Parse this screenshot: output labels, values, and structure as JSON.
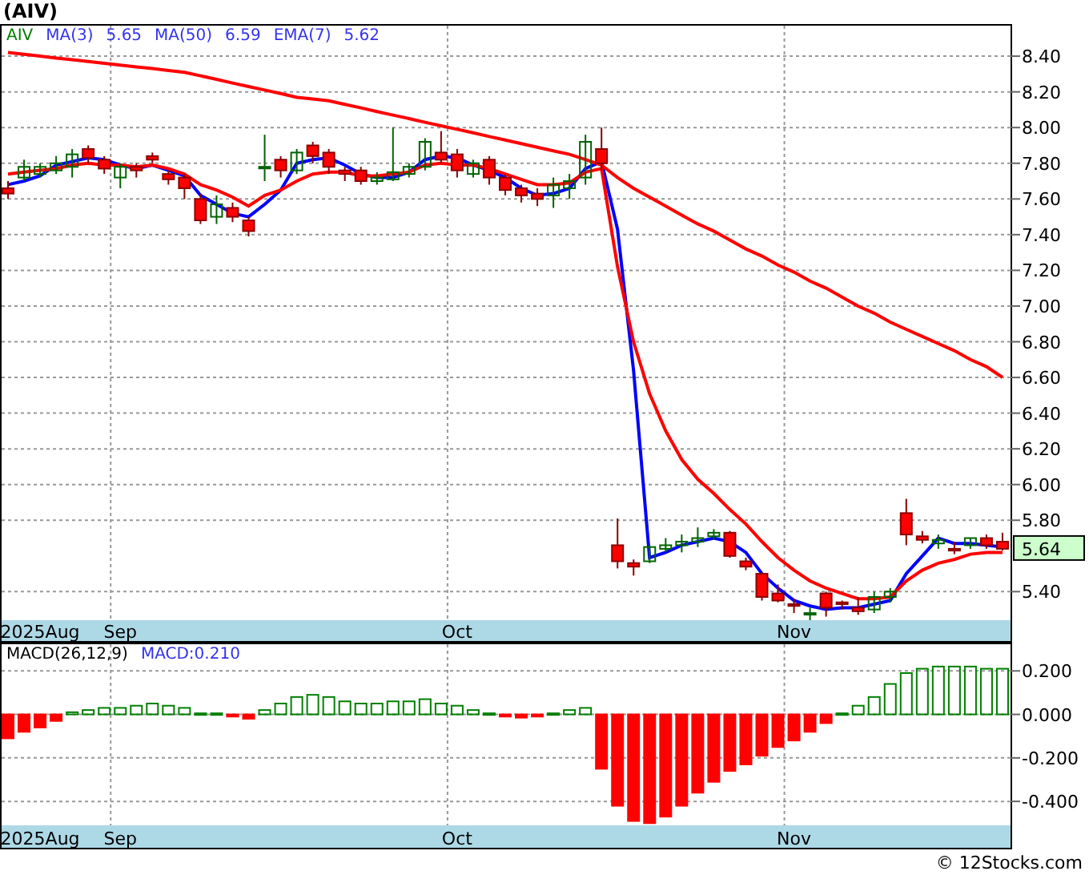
{
  "title": "(AIV)",
  "price_panel": {
    "legend": [
      {
        "text": "AIV",
        "color": "#008000"
      },
      {
        "text": "5.65",
        "color": "#3333ee"
      },
      {
        "text": "6.59",
        "color": "#3333ee"
      },
      {
        "text": "5.62",
        "color": "#3333ee"
      }
    ],
    "last_price": "5.64",
    "chart_data": {
      "type": "candlestick",
      "grid": true,
      "ylim": [
        5.24,
        8.58
      ],
      "categories": [
        null,
        null,
        "2025Aug",
        null,
        null,
        null,
        null,
        "Sep",
        null,
        null,
        null,
        null,
        null,
        null,
        null,
        null,
        null,
        null,
        null,
        null,
        null,
        null,
        null,
        null,
        null,
        null,
        null,
        null,
        "Oct",
        null,
        null,
        null,
        null,
        null,
        null,
        null,
        null,
        null,
        null,
        null,
        null,
        null,
        null,
        null,
        null,
        null,
        null,
        null,
        null,
        "Nov",
        null,
        null,
        null,
        null,
        null,
        null,
        null,
        null,
        null,
        null,
        null,
        null,
        null
      ],
      "yticks": [
        {
          "value": 8.4,
          "label": "8.40"
        },
        {
          "value": 8.2,
          "label": "8.20"
        },
        {
          "value": 8.0,
          "label": "8.00"
        },
        {
          "value": 7.8,
          "label": "7.80"
        },
        {
          "value": 7.6,
          "label": "7.60"
        },
        {
          "value": 7.4,
          "label": "7.40"
        },
        {
          "value": 7.2,
          "label": "7.20"
        },
        {
          "value": 7.0,
          "label": "7.00"
        },
        {
          "value": 6.8,
          "label": "6.80"
        },
        {
          "value": 6.6,
          "label": "6.60"
        },
        {
          "value": 6.4,
          "label": "6.40"
        },
        {
          "value": 6.2,
          "label": "6.20"
        },
        {
          "value": 6.0,
          "label": "6.00"
        },
        {
          "value": 5.8,
          "label": "5.80"
        },
        {
          "value": 5.4,
          "label": "5.40"
        }
      ],
      "ohlc": [
        [
          7.66,
          7.7,
          7.6,
          7.63
        ],
        [
          7.72,
          7.82,
          7.7,
          7.78
        ],
        [
          7.74,
          7.8,
          7.72,
          7.78
        ],
        [
          7.76,
          7.84,
          7.74,
          7.8
        ],
        [
          7.78,
          7.88,
          7.72,
          7.85
        ],
        [
          7.88,
          7.9,
          7.8,
          7.83
        ],
        [
          7.82,
          7.84,
          7.74,
          7.77
        ],
        [
          7.72,
          7.8,
          7.66,
          7.78
        ],
        [
          7.78,
          7.8,
          7.72,
          7.76
        ],
        [
          7.84,
          7.86,
          7.8,
          7.82
        ],
        [
          7.74,
          7.76,
          7.68,
          7.71
        ],
        [
          7.72,
          7.74,
          7.6,
          7.66
        ],
        [
          7.6,
          7.63,
          7.46,
          7.48
        ],
        [
          7.5,
          7.62,
          7.46,
          7.57
        ],
        [
          7.55,
          7.58,
          7.47,
          7.5
        ],
        [
          7.48,
          7.5,
          7.39,
          7.42
        ],
        [
          7.78,
          7.96,
          7.7,
          7.78
        ],
        [
          7.82,
          7.84,
          7.72,
          7.76
        ],
        [
          7.76,
          7.88,
          7.74,
          7.86
        ],
        [
          7.9,
          7.92,
          7.8,
          7.84
        ],
        [
          7.86,
          7.88,
          7.74,
          7.78
        ],
        [
          7.76,
          7.78,
          7.7,
          7.74
        ],
        [
          7.76,
          7.78,
          7.68,
          7.7
        ],
        [
          7.7,
          7.75,
          7.68,
          7.72
        ],
        [
          7.71,
          8.0,
          7.7,
          7.75
        ],
        [
          7.74,
          7.8,
          7.72,
          7.78
        ],
        [
          7.78,
          7.94,
          7.76,
          7.92
        ],
        [
          7.86,
          7.98,
          7.8,
          7.82
        ],
        [
          7.85,
          7.88,
          7.72,
          7.76
        ],
        [
          7.74,
          7.82,
          7.72,
          7.8
        ],
        [
          7.82,
          7.84,
          7.68,
          7.72
        ],
        [
          7.72,
          7.74,
          7.62,
          7.65
        ],
        [
          7.66,
          7.68,
          7.58,
          7.62
        ],
        [
          7.63,
          7.66,
          7.56,
          7.6
        ],
        [
          7.62,
          7.72,
          7.55,
          7.68
        ],
        [
          7.66,
          7.74,
          7.6,
          7.7
        ],
        [
          7.72,
          7.96,
          7.68,
          7.92
        ],
        [
          7.88,
          8.0,
          7.76,
          7.8
        ],
        [
          5.66,
          5.81,
          5.53,
          5.57
        ],
        [
          5.56,
          5.58,
          5.49,
          5.54
        ],
        [
          5.57,
          5.66,
          5.56,
          5.65
        ],
        [
          5.64,
          5.7,
          5.62,
          5.66
        ],
        [
          5.66,
          5.72,
          5.62,
          5.68
        ],
        [
          5.68,
          5.76,
          5.65,
          5.7
        ],
        [
          5.71,
          5.75,
          5.69,
          5.73
        ],
        [
          5.73,
          5.74,
          5.59,
          5.6
        ],
        [
          5.57,
          5.59,
          5.52,
          5.54
        ],
        [
          5.5,
          5.51,
          5.35,
          5.37
        ],
        [
          5.39,
          5.44,
          5.34,
          5.35
        ],
        [
          5.33,
          5.36,
          5.28,
          5.32
        ],
        [
          5.28,
          5.31,
          5.24,
          5.28
        ],
        [
          5.39,
          5.4,
          5.26,
          5.31
        ],
        [
          5.34,
          5.35,
          5.3,
          5.33
        ],
        [
          5.31,
          5.37,
          5.27,
          5.29
        ],
        [
          5.3,
          5.4,
          5.28,
          5.37
        ],
        [
          5.37,
          5.42,
          5.34,
          5.4
        ],
        [
          5.84,
          5.92,
          5.66,
          5.72
        ],
        [
          5.71,
          5.74,
          5.67,
          5.69
        ],
        [
          5.67,
          5.72,
          5.64,
          5.69
        ],
        [
          5.64,
          5.68,
          5.61,
          5.63
        ],
        [
          5.66,
          5.7,
          5.64,
          5.7
        ],
        [
          5.7,
          5.72,
          5.64,
          5.66
        ],
        [
          5.68,
          5.73,
          5.63,
          5.64
        ]
      ],
      "series": [
        {
          "name": "MA(3)",
          "type": "line",
          "color": "#0000ff",
          "values": [
            7.68,
            7.7,
            7.73,
            7.79,
            7.81,
            7.83,
            7.82,
            7.79,
            7.77,
            7.79,
            7.76,
            7.73,
            7.62,
            7.57,
            7.52,
            7.5,
            7.57,
            7.65,
            7.8,
            7.82,
            7.83,
            7.79,
            7.74,
            7.72,
            7.72,
            7.75,
            7.82,
            7.84,
            7.83,
            7.79,
            7.76,
            7.72,
            7.66,
            7.62,
            7.63,
            7.66,
            7.77,
            7.81,
            7.43,
            6.64,
            5.59,
            5.62,
            5.66,
            5.68,
            5.7,
            5.68,
            5.62,
            5.5,
            5.42,
            5.35,
            5.32,
            5.3,
            5.31,
            5.31,
            5.33,
            5.35,
            5.5,
            5.6,
            5.7,
            5.67,
            5.67,
            5.66,
            5.65
          ]
        },
        {
          "name": "MA(50)",
          "type": "line",
          "color": "#ff0000",
          "values": [
            8.42,
            8.41,
            8.4,
            8.39,
            8.38,
            8.37,
            8.36,
            8.35,
            8.34,
            8.33,
            8.32,
            8.31,
            8.29,
            8.27,
            8.25,
            8.23,
            8.21,
            8.19,
            8.17,
            8.16,
            8.15,
            8.13,
            8.11,
            8.09,
            8.07,
            8.05,
            8.03,
            8.01,
            7.99,
            7.97,
            7.95,
            7.93,
            7.91,
            7.89,
            7.87,
            7.85,
            7.82,
            7.79,
            7.72,
            7.66,
            7.61,
            7.56,
            7.51,
            7.46,
            7.42,
            7.37,
            7.32,
            7.28,
            7.23,
            7.19,
            7.14,
            7.1,
            7.05,
            7.0,
            6.96,
            6.91,
            6.87,
            6.83,
            6.79,
            6.75,
            6.7,
            6.66,
            6.6
          ]
        },
        {
          "name": "EMA(7)",
          "type": "line",
          "color": "#ff0000",
          "values": [
            7.74,
            7.75,
            7.76,
            7.77,
            7.79,
            7.8,
            7.79,
            7.79,
            7.78,
            7.79,
            7.77,
            7.74,
            7.68,
            7.65,
            7.61,
            7.56,
            7.62,
            7.65,
            7.7,
            7.74,
            7.75,
            7.75,
            7.73,
            7.73,
            7.74,
            7.75,
            7.79,
            7.8,
            7.79,
            7.79,
            7.77,
            7.74,
            7.71,
            7.68,
            7.68,
            7.69,
            7.75,
            7.77,
            7.22,
            6.8,
            6.51,
            6.3,
            6.14,
            6.03,
            5.95,
            5.86,
            5.78,
            5.68,
            5.59,
            5.52,
            5.46,
            5.42,
            5.39,
            5.36,
            5.36,
            5.37,
            5.46,
            5.52,
            5.56,
            5.58,
            5.61,
            5.62,
            5.62
          ]
        }
      ]
    }
  },
  "macd_panel": {
    "legend": [
      {
        "text": "MACD(26,12,9)",
        "color": "#000000"
      },
      {
        "text": "MACD:0.210",
        "color": "#3333ee"
      }
    ],
    "chart_data": {
      "type": "bar",
      "grid": true,
      "ylim": [
        -0.51,
        0.33
      ],
      "categories": [
        null,
        null,
        "2025Aug",
        null,
        null,
        null,
        null,
        "Sep",
        null,
        null,
        null,
        null,
        null,
        null,
        null,
        null,
        null,
        null,
        null,
        null,
        null,
        null,
        null,
        null,
        null,
        null,
        null,
        null,
        "Oct",
        null,
        null,
        null,
        null,
        null,
        null,
        null,
        null,
        null,
        null,
        null,
        null,
        null,
        null,
        null,
        null,
        null,
        null,
        null,
        null,
        "Nov",
        null,
        null,
        null,
        null,
        null,
        null,
        null,
        null,
        null,
        null,
        null,
        null,
        null
      ],
      "yticks": [
        {
          "value": 0.2,
          "label": "0.200"
        },
        {
          "value": 0,
          "label": "0.000"
        },
        {
          "value": -0.2,
          "label": "-0.200"
        },
        {
          "value": -0.4,
          "label": "-0.400"
        }
      ],
      "series": [
        {
          "color": "#008000",
          "values": [
            null,
            null,
            null,
            null,
            0.01,
            0.02,
            0.03,
            0.03,
            0.04,
            0.05,
            0.04,
            0.03,
            0.005,
            0.005,
            null,
            null,
            0.02,
            0.05,
            0.08,
            0.09,
            0.08,
            0.06,
            0.05,
            0.05,
            0.06,
            0.06,
            0.07,
            0.05,
            0.04,
            0.02,
            0.005,
            null,
            null,
            null,
            0.005,
            0.02,
            0.03,
            null,
            null,
            null,
            null,
            null,
            null,
            null,
            null,
            null,
            null,
            null,
            null,
            null,
            null,
            null,
            0.005,
            0.04,
            0.08,
            0.14,
            0.19,
            0.21,
            0.22,
            0.22,
            0.22,
            0.21,
            0.21
          ]
        },
        {
          "color": "#ff0000",
          "values": [
            -0.11,
            -0.08,
            -0.06,
            -0.03,
            null,
            null,
            null,
            null,
            null,
            null,
            null,
            null,
            null,
            null,
            -0.01,
            -0.02,
            null,
            null,
            null,
            null,
            null,
            null,
            null,
            null,
            null,
            null,
            null,
            null,
            null,
            null,
            null,
            -0.01,
            -0.015,
            -0.01,
            null,
            null,
            null,
            -0.25,
            -0.42,
            -0.49,
            -0.5,
            -0.47,
            -0.42,
            -0.36,
            -0.31,
            -0.26,
            -0.23,
            -0.19,
            -0.15,
            -0.12,
            -0.08,
            -0.04,
            null,
            null,
            null,
            null,
            null,
            null,
            null,
            null,
            null,
            null,
            null
          ]
        }
      ]
    }
  },
  "copyright": "© 12Stocks.com"
}
